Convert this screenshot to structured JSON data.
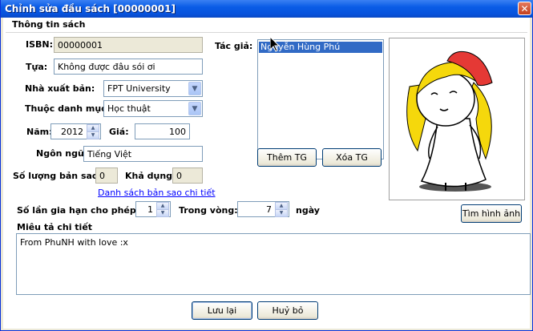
{
  "window": {
    "title": "Chỉnh sửa đầu sách [00000001]",
    "close_glyph": "✕"
  },
  "group": {
    "title": "Thông tin sách"
  },
  "isbn": {
    "label": "ISBN:",
    "value": "00000001"
  },
  "title_field": {
    "label": "Tựa:",
    "value": "Không được đâu sói ơi"
  },
  "publisher": {
    "label": "Nhà xuất bản:",
    "value": "FPT University"
  },
  "category": {
    "label": "Thuộc danh mục:",
    "value": "Học thuật"
  },
  "year": {
    "label": "Năm:",
    "value": "2012"
  },
  "price": {
    "label": "Giá:",
    "value": "100"
  },
  "language": {
    "label": "Ngôn ngữ",
    "value": "Tiếng Việt"
  },
  "copies": {
    "label": "Số lượng bản sao:",
    "value": "0"
  },
  "available": {
    "label": "Khả dụng:",
    "value": "0"
  },
  "copies_link": "Danh sách bản sao chi tiết",
  "authors": {
    "label": "Tác giả:",
    "items": [
      "Nguyễn Hùng Phú"
    ]
  },
  "author_buttons": {
    "add": "Thêm TG",
    "remove": "Xóa TG"
  },
  "image_button": "Tìm hình ảnh",
  "renewals": {
    "label": "Số lần gia hạn cho phép:",
    "value": "1"
  },
  "within": {
    "label": "Trong vòng:",
    "value": "7",
    "unit": "ngày"
  },
  "description": {
    "label": "Miêu tả chi tiết",
    "value": "From PhuNH with love :x"
  },
  "footer": {
    "save": "Lưu lại",
    "cancel": "Huỷ bỏ"
  },
  "colors": {
    "title_bar": "#0752dc",
    "selection": "#316ac5",
    "link": "#0000ff",
    "hat": "#e53935",
    "hair": "#f5d80c"
  }
}
